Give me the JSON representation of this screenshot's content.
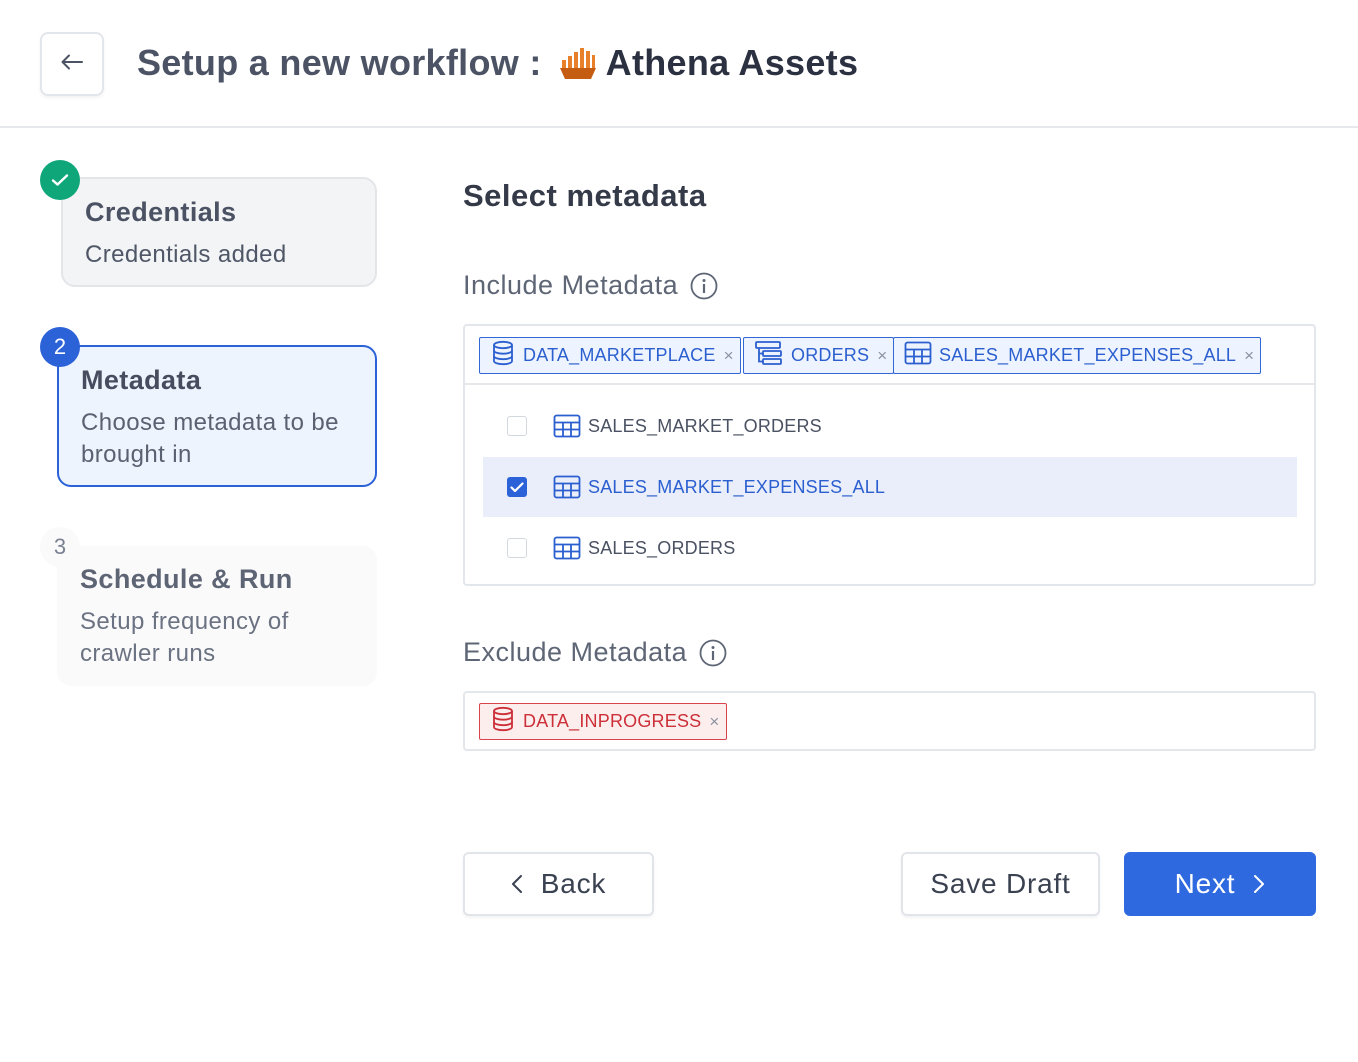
{
  "header": {
    "title_prefix": "Setup a new workflow :",
    "connector_name": "Athena Assets",
    "back_icon": "arrow-left-icon",
    "logo_icon": "athena-logo-icon"
  },
  "steps": [
    {
      "number": "1",
      "title": "Credentials",
      "description": "Credentials added",
      "status": "completed"
    },
    {
      "number": "2",
      "title": "Metadata",
      "description": "Choose metadata to be brought in",
      "status": "active"
    },
    {
      "number": "3",
      "title": "Schedule & Run",
      "description": "Setup frequency of crawler runs",
      "status": "pending"
    }
  ],
  "main": {
    "section_title": "Select metadata",
    "include": {
      "label": "Include Metadata",
      "tags": [
        {
          "label": "DATA_MARKETPLACE",
          "icon": "database-icon"
        },
        {
          "label": "ORDERS",
          "icon": "schema-icon"
        },
        {
          "label": "SALES_MARKET_EXPENSES_ALL",
          "icon": "table-icon"
        }
      ],
      "options": [
        {
          "label": "SALES_MARKET_ORDERS",
          "checked": false
        },
        {
          "label": "SALES_MARKET_EXPENSES_ALL",
          "checked": true
        },
        {
          "label": "SALES_ORDERS",
          "checked": false
        }
      ]
    },
    "exclude": {
      "label": "Exclude Metadata",
      "tags": [
        {
          "label": "DATA_INPROGRESS",
          "icon": "database-icon"
        }
      ]
    }
  },
  "footer": {
    "back_label": "Back",
    "save_draft_label": "Save Draft",
    "next_label": "Next"
  },
  "colors": {
    "primary": "#2f69e0",
    "success": "#0fa77a",
    "danger": "#cc2f38",
    "logo_orange": "#e8802a"
  }
}
